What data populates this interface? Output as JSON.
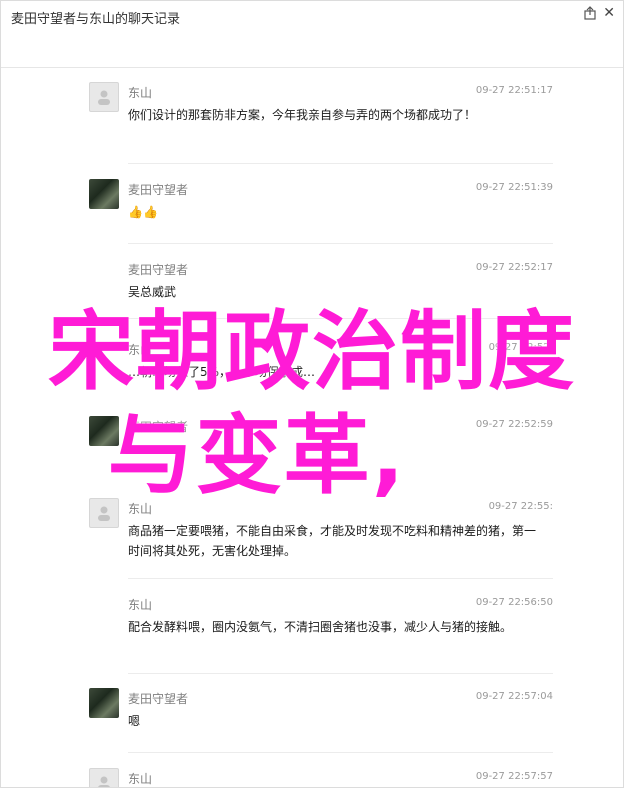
{
  "window": {
    "title": "麦田守望者与东山的聊天记录",
    "close_glyph": "✕"
  },
  "messages": [
    {
      "sender": "东山",
      "time": "09-27 22:51:17",
      "text": "你们设计的那套防非方案，今年我亲自参与弄的两个场都成功了！",
      "avatar": "gray"
    },
    {
      "sender": "麦田守望者",
      "time": "09-27 22:51:39",
      "text": "👍👍",
      "avatar": "photo"
    },
    {
      "sender": "麦田守望者",
      "time": "09-27 22:52:17",
      "text": "吴总威武",
      "avatar": "none"
    },
    {
      "sender": "东山",
      "time": "09-27 22:52:",
      "text": "…朝…场保了5%，一个场保了成…",
      "avatar": "none"
    },
    {
      "sender": "麦田守望者",
      "time": "09-27 22:52:59",
      "text": "",
      "avatar": "photo"
    },
    {
      "sender": "东山",
      "time": "09-27 22:55:",
      "text": "商品猪一定要喂猪，不能自由采食，才能及时发现不吃料和精神差的猪，第一时间将其处死，无害化处理掉。",
      "avatar": "gray"
    },
    {
      "sender": "东山",
      "time": "09-27 22:56:50",
      "text": "配合发酵料喂，圈内没氨气，不清扫圈舍猪也没事，减少人与猪的接触。",
      "avatar": "none"
    },
    {
      "sender": "麦田守望者",
      "time": "09-27 22:57:04",
      "text": "嗯",
      "avatar": "photo"
    },
    {
      "sender": "东山",
      "time": "09-27 22:57:57",
      "text": "",
      "avatar": "gray"
    }
  ],
  "overlay": {
    "line1": "宋朝政治制度",
    "line2": "与变革,",
    "color": "#ff1bd6"
  }
}
